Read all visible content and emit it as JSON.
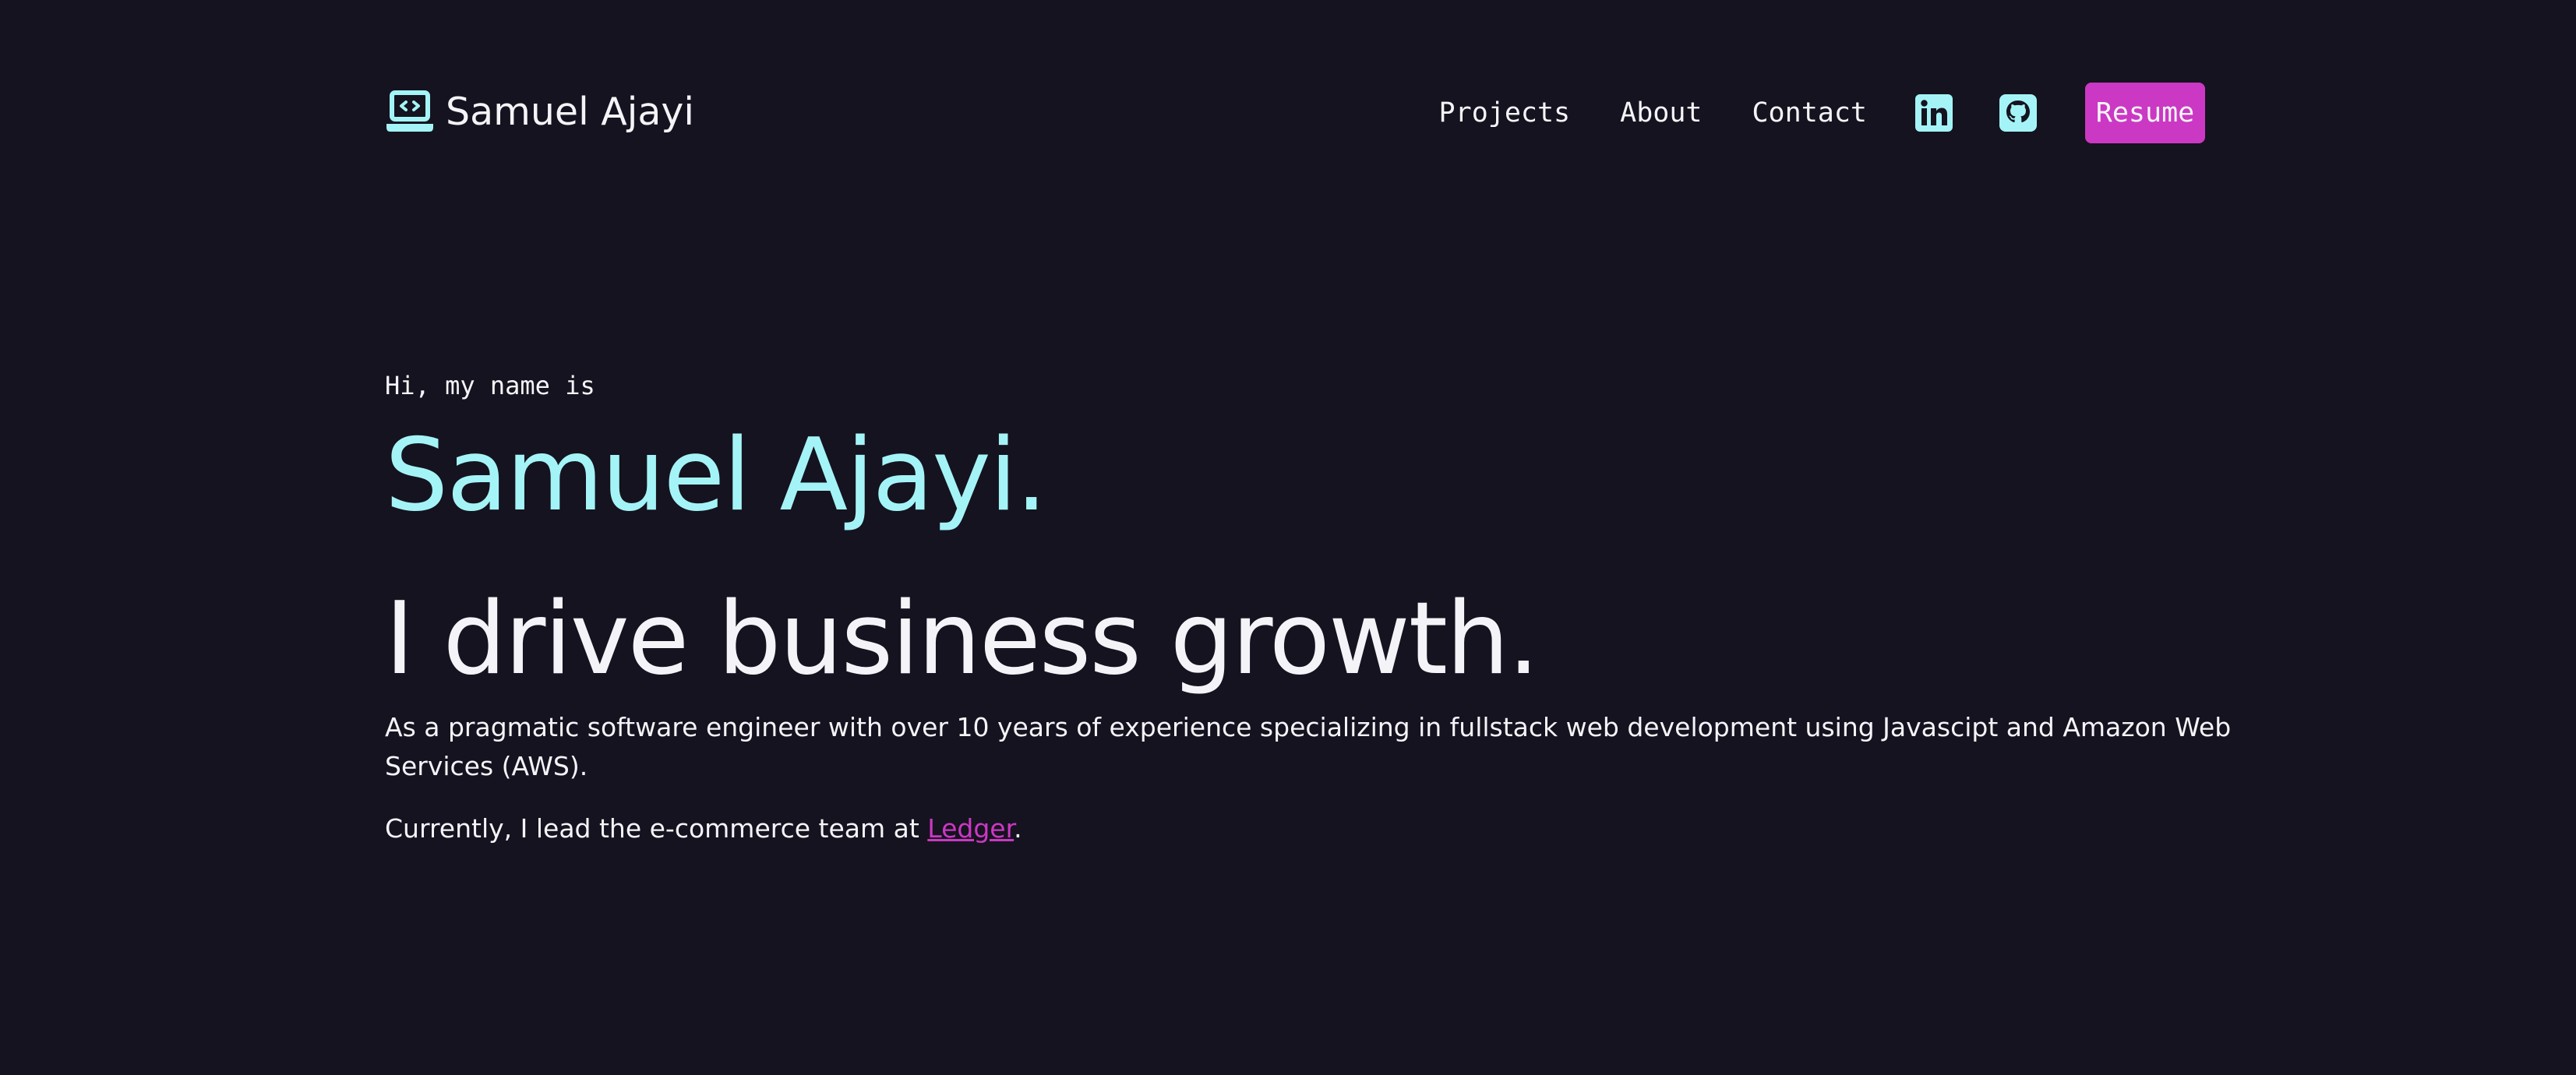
{
  "header": {
    "brand_name": "Samuel Ajayi",
    "brand_icon": "laptop-code-icon",
    "nav_items": [
      {
        "label": "Projects"
      },
      {
        "label": "About"
      },
      {
        "label": "Contact"
      }
    ],
    "social_icons": [
      "linkedin-icon",
      "github-icon"
    ],
    "resume_label": "Resume"
  },
  "hero": {
    "greeting": "Hi, my name is",
    "name": "Samuel Ajayi.",
    "tagline": "I drive business growth.",
    "bio": "As a pragmatic software engineer with over 10 years of experience specializing in fullstack web development using Javascipt and Amazon Web Services (AWS).",
    "current_prefix": "Currently, I lead the e-commerce team at ",
    "company_link": "Ledger",
    "current_suffix": "."
  },
  "colors": {
    "background": "#15131f",
    "accent_cyan": "#a4f4f7",
    "accent_pink": "#cb38c3",
    "text": "#f4f4f8"
  }
}
